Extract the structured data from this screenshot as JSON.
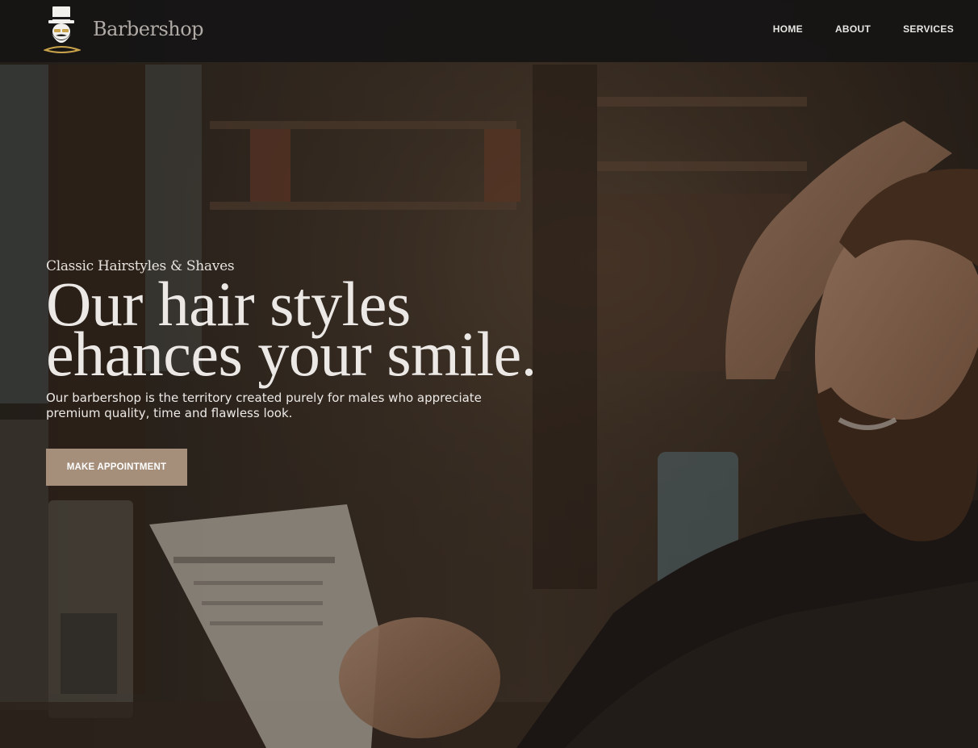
{
  "navbar": {
    "brand": "Barbershop",
    "links": [
      "HOME",
      "ABOUT",
      "SERVICES"
    ]
  },
  "hero": {
    "eyebrow": "Classic Hairstyles & Shaves",
    "headline_line1": "Our hair styles",
    "headline_line2": "ehances your smile.",
    "description": "Our barbershop is the territory created purely for males who appreciate premium quality, time and flawless look.",
    "cta_label": "MAKE APPOINTMENT"
  },
  "colors": {
    "navbar_bg": "#161414",
    "cta_bg": "#a58e7a",
    "logo_accent": "#c9a34a"
  },
  "icons": {
    "logo": "barber-gentleman-logo-icon"
  }
}
